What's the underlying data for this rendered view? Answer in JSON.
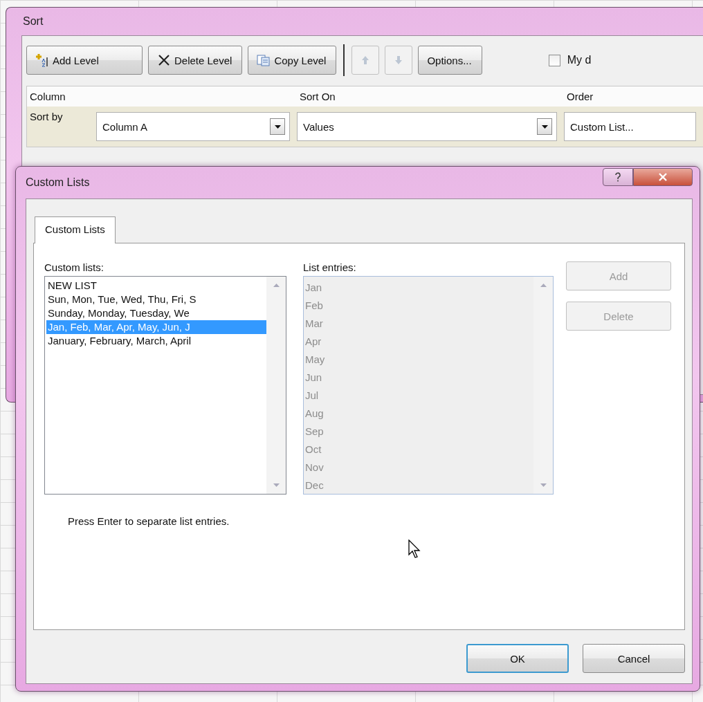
{
  "sort_window": {
    "title": "Sort",
    "toolbar": [
      {
        "kind": "button",
        "label": "Add Level",
        "disabled": false
      },
      {
        "kind": "button",
        "label": "Delete Level",
        "disabled": false
      },
      {
        "kind": "button",
        "label": "Copy Level",
        "disabled": false
      },
      {
        "kind": "up_button",
        "disabled": true
      },
      {
        "kind": "down_button",
        "disabled": true
      },
      {
        "kind": "button",
        "label": "Options...",
        "disabled": false
      },
      {
        "kind": "checkbox",
        "label": "My d",
        "checked": false
      }
    ],
    "columns": [
      "Column",
      "Sort On",
      "Order"
    ],
    "levels": [
      {
        "label": "Sort by",
        "column": "Column A",
        "sort_on": "Values",
        "order": "Custom List...",
        "selected": true
      }
    ]
  },
  "custom_lists_dialog": {
    "title": "Custom Lists",
    "tabs": [
      {
        "label": "Custom Lists",
        "selected": true
      }
    ],
    "lists_label": "Custom lists:",
    "lists": [
      {
        "text": "NEW LIST",
        "selected": false
      },
      {
        "text": "Sun, Mon, Tue, Wed, Thu, Fri, S",
        "selected": false
      },
      {
        "text": "Sunday, Monday, Tuesday, We",
        "selected": false
      },
      {
        "text": "Jan, Feb, Mar, Apr, May, Jun, J",
        "selected": true
      },
      {
        "text": "January, February, March, April",
        "selected": false
      }
    ],
    "entries_label": "List entries:",
    "entries_disabled": true,
    "entries": [
      "Jan",
      "Feb",
      "Mar",
      "Apr",
      "May",
      "Jun",
      "Jul",
      "Aug",
      "Sep",
      "Oct",
      "Nov",
      "Dec"
    ],
    "side_buttons": [
      {
        "label": "Add",
        "disabled": true
      },
      {
        "label": "Delete",
        "disabled": true
      }
    ],
    "hint": "Press Enter to separate list entries.",
    "footer_buttons": [
      {
        "label": "OK",
        "default": true
      },
      {
        "label": "Cancel",
        "default": false
      }
    ]
  }
}
